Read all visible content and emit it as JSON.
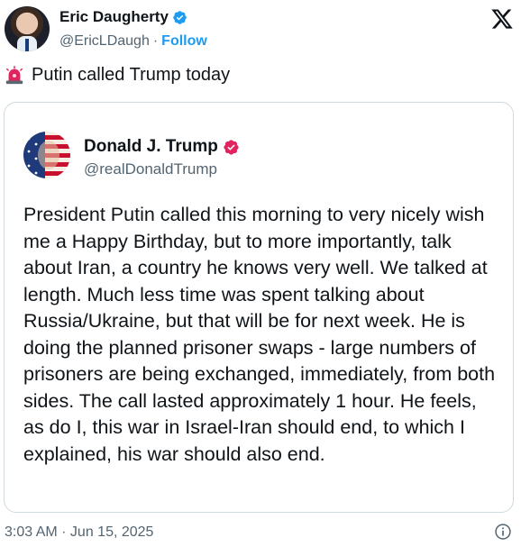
{
  "author": {
    "name": "Eric Daugherty",
    "handle": "@EricLDaugh",
    "separator": "·",
    "follow_label": "Follow"
  },
  "tweet": {
    "text": "Putin called Trump today",
    "emoji_icon": "siren-icon"
  },
  "quoted": {
    "name": "Donald J. Trump",
    "handle": "@realDonaldTrump",
    "body": "President Putin called this morning to very nicely wish me a Happy Birthday, but to more importantly, talk about Iran, a country he knows very well. We talked at length. Much less time was spent talking about Russia/Ukraine, but that will be for next week. He is doing the planned prisoner swaps - large numbers of prisoners are being exchanged, immediately, from both sides. The call lasted approximately 1 hour. He feels, as do I, this war in Israel-Iran should end, to which I explained, his war should also end."
  },
  "footer": {
    "timestamp": "3:03 AM · Jun 15, 2025"
  },
  "colors": {
    "accent": "#1d9bf0",
    "verified_red": "#e0245e",
    "muted": "#536471"
  }
}
